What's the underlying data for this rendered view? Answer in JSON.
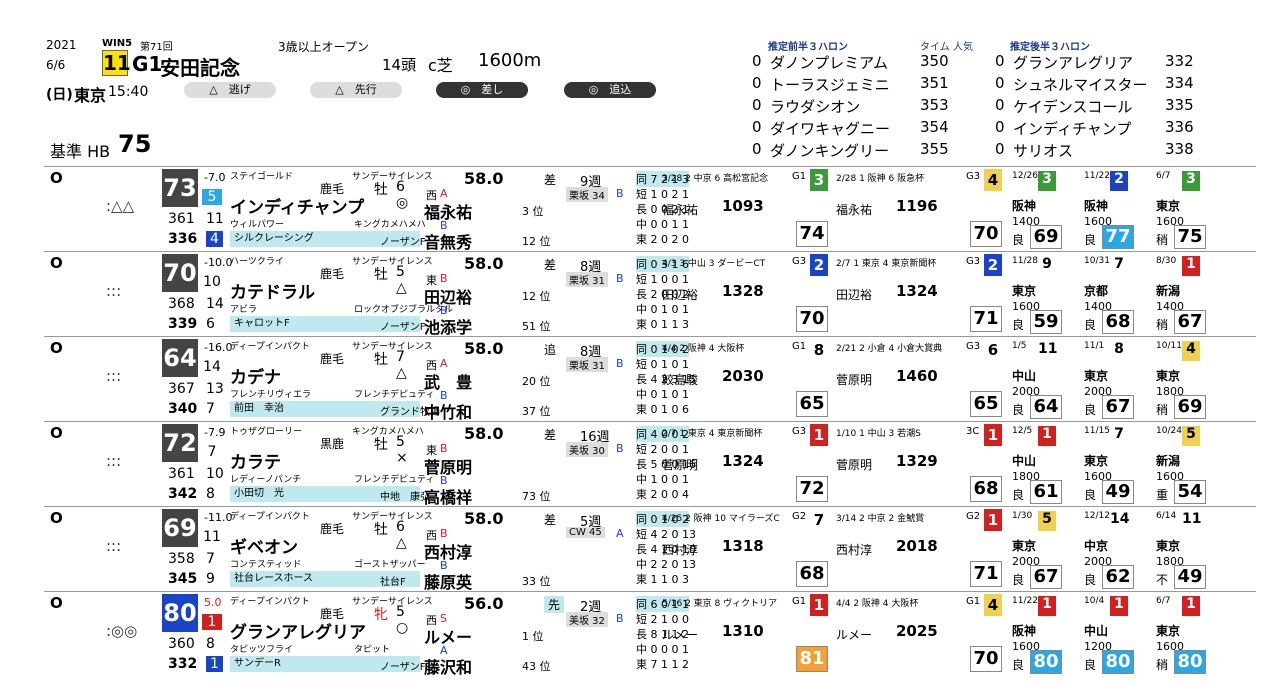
{
  "header": {
    "year": "2021",
    "date": "6/6",
    "win5": "WIN5",
    "kai": "第71回",
    "race_no": "11",
    "grade": "G1",
    "race_name": "安田記念",
    "condition": "3歳以上オープン",
    "runners": "14頭",
    "course": "c芝",
    "distance": "1600m",
    "day": "(日)",
    "place": "東京",
    "time": "15:40",
    "base_label": "基準 HB",
    "base_value": "75",
    "styles": [
      "△　逃げ",
      "△　先行",
      "◎　差し",
      "◎　追込"
    ]
  },
  "rank_heads": {
    "front": "推定前半３ハロン",
    "time_pop": "タイム 人気",
    "back": "推定後半３ハロン"
  },
  "front_rank": [
    {
      "mark": "0",
      "name": "ダノンプレミアム",
      "value": "350"
    },
    {
      "mark": "0",
      "name": "トーラスジェミニ",
      "value": "351"
    },
    {
      "mark": "0",
      "name": "ラウダシオン",
      "value": "353"
    },
    {
      "mark": "0",
      "name": "ダイワキャグニー",
      "value": "354"
    },
    {
      "mark": "0",
      "name": "ダノンキングリー",
      "value": "355"
    }
  ],
  "back_rank": [
    {
      "mark": "0",
      "name": "グランアレグリア",
      "value": "332"
    },
    {
      "mark": "0",
      "name": "シュネルマイスター",
      "value": "334"
    },
    {
      "mark": "0",
      "name": "ケイデンスコール",
      "value": "335"
    },
    {
      "mark": "0",
      "name": "インディチャンプ",
      "value": "336"
    },
    {
      "mark": "0",
      "name": "サリオス",
      "value": "338"
    }
  ],
  "horses": [
    {
      "mark": "O",
      "pred": ":△△",
      "score": "73",
      "d1": "-7.0",
      "wk": "5",
      "h1": "361",
      "h1n": "11",
      "h2": "336",
      "h2n": "4",
      "sire": "ステイゴールド",
      "bms": "サンデーサイレンス",
      "coat": "鹿毛",
      "sex": "牡",
      "age": "6",
      "name": "インディチャンプ",
      "fmark": "◎",
      "dam": "ウィルパワー",
      "damsire": "キングカメハメハ",
      "owner": "シルクレーシング",
      "farm": "ノーザンF",
      "weight": "58.0",
      "stable": "西",
      "stableRank": "A",
      "style": "差",
      "jockey": "福永祐",
      "jstat": "3 位",
      "trainer": "音無秀",
      "tstat": "12 位",
      "trainerRank": "B",
      "interval": "9週",
      "stat1": "栗坂 34",
      "r1": "B",
      "recs": [
        "同 7 2 1 3",
        "短 1 0 2 1",
        "長 0 0 2 1",
        "中 0 0 1 1",
        "東 2 0 2 0"
      ],
      "p1_head": "3/28 2 中京 6 高松宮記念",
      "p1_g": "G1",
      "p1_rank": "3",
      "p1_rc": "#3a9a3a",
      "p1_jockey": "福永祐",
      "p1_time": "1093",
      "p1_sc": "74",
      "p2_head": "2/28 1 阪神 6 阪急杯",
      "p2_g": "G3",
      "p2_rank": "4",
      "p2_rc": "#f0d050",
      "p2_jockey": "福永祐",
      "p2_time": "1196",
      "p2_sc": "70",
      "r3": [
        "12/26",
        "阪神",
        "1400",
        "良",
        "69",
        "3",
        "#3a9a3a"
      ],
      "r4": [
        "11/22",
        "阪神",
        "1600",
        "良",
        "77",
        "2",
        "#1a44c4"
      ],
      "r5": [
        "6/7",
        "東京",
        "1600",
        "稍",
        "75",
        "3",
        "#3a9a3a"
      ]
    },
    {
      "mark": "O",
      "pred": ":::",
      "score": "70",
      "d1": "-10.0",
      "wk": "10",
      "h1": "368",
      "h1n": "14",
      "h2": "339",
      "h2n": "6",
      "sire": "ハーツクライ",
      "bms": "サンデーサイレンス",
      "coat": "鹿毛",
      "sex": "牡",
      "age": "5",
      "name": "カテドラル",
      "fmark": "△",
      "dam": "アビラ",
      "damsire": "ロックオブジブラルタル",
      "owner": "キャロットF",
      "farm": "ノーザンF",
      "weight": "58.0",
      "stable": "東",
      "stableRank": "B",
      "style": "差",
      "jockey": "田辺裕",
      "jstat": "12 位",
      "trainer": "池添学",
      "tstat": "51 位",
      "trainerRank": "B",
      "interval": "8週",
      "stat1": "栗坂 31",
      "r1": "B",
      "recs": [
        "同 0 3 1 6",
        "短 1 0 0 1",
        "長 2 0 0 2",
        "中 0 1 0 1",
        "東 0 1 1 3"
      ],
      "p1_head": "4/3 3 中山 3 ダービーCT",
      "p1_g": "G3",
      "p1_rank": "2",
      "p1_rc": "#1a44c4",
      "p1_jockey": "田辺裕",
      "p1_time": "1328",
      "p1_sc": "70",
      "p2_head": "2/7 1 東京 4 東京新聞杯",
      "p2_g": "G3",
      "p2_rank": "2",
      "p2_rc": "#1a44c4",
      "p2_jockey": "田辺裕",
      "p2_time": "1324",
      "p2_sc": "71",
      "r3": [
        "11/28",
        "東京",
        "1600",
        "良",
        "59",
        "9",
        ""
      ],
      "r4": [
        "10/31",
        "京都",
        "1400",
        "良",
        "68",
        "7",
        ""
      ],
      "r5": [
        "8/30",
        "新潟",
        "1400",
        "稍",
        "67",
        "1",
        "#d02020"
      ]
    },
    {
      "mark": "O",
      "pred": ":::",
      "score": "64",
      "d1": "-16.0",
      "wk": "14",
      "h1": "367",
      "h1n": "13",
      "h2": "340",
      "h2n": "7",
      "sire": "ディープインパクト",
      "bms": "サンデーサイレンス",
      "coat": "鹿毛",
      "sex": "牡",
      "age": "7",
      "name": "カデナ",
      "fmark": "△",
      "dam": "フレンチリヴィエラ",
      "damsire": "フレンチデピュティ",
      "owner": "前田　幸治",
      "farm": "グランド牧場",
      "weight": "58.0",
      "stable": "西",
      "stableRank": "A",
      "style": "追",
      "jockey": "武　豊",
      "jstat": "20 位",
      "trainer": "中竹和",
      "tstat": "37 位",
      "trainerRank": "B",
      "interval": "8週",
      "stat1": "栗坂 31",
      "r1": "B",
      "recs": [
        "同 0 1 0 2",
        "短 0 1 0 1",
        "長 4 2 3 15",
        "中 0 1 0 1",
        "東 0 1 0 6"
      ],
      "p1_head": "4/4 2 阪神 4 大阪杯",
      "p1_g": "G1",
      "p1_rank": "8",
      "p1_rc": "",
      "p1_jockey": "鮫島駿",
      "p1_time": "2030",
      "p1_sc": "65",
      "p2_head": "2/21 2 小倉 4 小倉大賞典",
      "p2_g": "G3",
      "p2_rank": "6",
      "p2_rc": "",
      "p2_jockey": "菅原明",
      "p2_time": "1460",
      "p2_sc": "65",
      "r3": [
        "1/5",
        "中山",
        "2000",
        "良",
        "64",
        "11",
        ""
      ],
      "r4": [
        "11/1",
        "東京",
        "2000",
        "良",
        "67",
        "8",
        ""
      ],
      "r5": [
        "10/11",
        "東京",
        "1800",
        "稍",
        "69",
        "4",
        "#f0d050"
      ]
    },
    {
      "mark": "O",
      "pred": ":::",
      "score": "72",
      "d1": "-7.9",
      "wk": "7",
      "h1": "361",
      "h1n": "10",
      "h2": "342",
      "h2n": "8",
      "sire": "トゥザグローリー",
      "bms": "キングカメハメハ",
      "coat": "黒鹿",
      "sex": "牡",
      "age": "5",
      "name": "カラテ",
      "fmark": "×",
      "dam": "レディーノパンチ",
      "damsire": "フレンチデピュティ",
      "owner": "小田切　光",
      "farm": "中地　康弘",
      "weight": "58.0",
      "stable": "東",
      "stableRank": "B",
      "style": "差",
      "jockey": "菅原明",
      "jstat": "",
      "trainer": "高橋祥",
      "tstat": "73 位",
      "trainerRank": "B",
      "interval": "16週",
      "stat1": "美坂 30",
      "r1": "B",
      "recs": [
        "同 4 0 0 2",
        "短 2 0 0 1",
        "長 5 0 0 16",
        "中 1 0 0 1",
        "東 2 0 0 4"
      ],
      "p1_head": "2/7 1 東京 4 東京新聞杯",
      "p1_g": "G3",
      "p1_rank": "1",
      "p1_rc": "#d02020",
      "p1_jockey": "菅原明",
      "p1_time": "1324",
      "p1_sc": "72",
      "p2_head": "1/10 1 中山 3 若潮S",
      "p2_g": "3C",
      "p2_rank": "1",
      "p2_rc": "#d02020",
      "p2_jockey": "菅原明",
      "p2_time": "1329",
      "p2_sc": "68",
      "r3": [
        "12/5",
        "中山",
        "1800",
        "良",
        "61",
        "1",
        "#d02020"
      ],
      "r4": [
        "11/15",
        "東京",
        "1600",
        "良",
        "49",
        "7",
        ""
      ],
      "r5": [
        "10/24",
        "新潟",
        "1600",
        "重",
        "54",
        "5",
        "#f0d050"
      ]
    },
    {
      "mark": "O",
      "pred": ":::",
      "score": "69",
      "d1": "-11.0",
      "wk": "11",
      "h1": "358",
      "h1n": "7",
      "h2": "345",
      "h2n": "9",
      "sire": "ディープインパクト",
      "bms": "サンデーサイレンス",
      "coat": "鹿毛",
      "sex": "牡",
      "age": "6",
      "name": "ギベオン",
      "fmark": "△",
      "dam": "コンテスティッド",
      "damsire": "ゴーストザッパー",
      "owner": "社台レースホース",
      "farm": "社台F",
      "weight": "58.0",
      "stable": "西",
      "stableRank": "B",
      "style": "差",
      "jockey": "西村淳",
      "jstat": "",
      "trainer": "藤原英",
      "tstat": "33 位",
      "trainerRank": "B",
      "interval": "5週",
      "stat1": "CW 45",
      "r1": "A",
      "recs": [
        "同 0 1 0 2",
        "短 4 2 0 13",
        "長 4 1 0 10",
        "中 2 2 0 13",
        "東 1 1 0 3"
      ],
      "p1_head": "4/25 2 阪神 10 マイラーズC",
      "p1_g": "G2",
      "p1_rank": "7",
      "p1_rc": "",
      "p1_jockey": "西村淳",
      "p1_time": "1318",
      "p1_sc": "68",
      "p2_head": "3/14 2 中京 2 金鯱賞",
      "p2_g": "G2",
      "p2_rank": "1",
      "p2_rc": "#d02020",
      "p2_jockey": "西村淳",
      "p2_time": "2018",
      "p2_sc": "71",
      "r3": [
        "1/30",
        "東京",
        "2000",
        "良",
        "67",
        "5",
        "#f0d050"
      ],
      "r4": [
        "12/12",
        "中京",
        "2000",
        "良",
        "62",
        "14",
        ""
      ],
      "r5": [
        "6/14",
        "東京",
        "1800",
        "不",
        "49",
        "11",
        ""
      ]
    },
    {
      "mark": "O",
      "pred": ":◎◎",
      "score": "80",
      "d1": "5.0",
      "wk": "1",
      "h1": "360",
      "h1n": "8",
      "h2": "332",
      "h2n": "1",
      "sire": "ディープインパクト",
      "bms": "サンデーサイレンス",
      "coat": "鹿毛",
      "sex": "牝",
      "age": "5",
      "name": "グランアレグリア",
      "fmark": "○",
      "dam": "タピッツフライ",
      "damsire": "タピット",
      "owner": "サンデーR",
      "farm": "ノーザンF",
      "weight": "56.0",
      "stable": "西",
      "stableRank": "S",
      "style": "先",
      "jockey": "ルメー",
      "jstat": "1 位",
      "trainer": "藤沢和",
      "tstat": "43 位",
      "trainerRank": "A",
      "interval": "2週",
      "stat1": "美坂 32",
      "r1": "B",
      "recs": [
        "同 6 0 1 1",
        "短 2 1 0 0",
        "長 8 1 1 2",
        "中 0 0 0 1",
        "東 7 1 1 2"
      ],
      "p1_head": "5/16 2 東京 8 ヴィクトリア",
      "p1_g": "G1",
      "p1_rank": "1",
      "p1_rc": "#d02020",
      "p1_jockey": "ルメー",
      "p1_time": "1310",
      "p1_sc": "81",
      "p2_head": "4/4 2 阪神 4 大阪杯",
      "p2_g": "G1",
      "p2_rank": "4",
      "p2_rc": "#f0d050",
      "p2_jockey": "ルメー",
      "p2_time": "2025",
      "p2_sc": "70",
      "r3": [
        "11/22",
        "阪神",
        "1600",
        "良",
        "80",
        "1",
        "#d02020"
      ],
      "r4": [
        "10/4",
        "中山",
        "1200",
        "良",
        "80",
        "1",
        "#d02020"
      ],
      "r5": [
        "6/7",
        "東京",
        "1600",
        "稍",
        "80",
        "1",
        "#d02020"
      ]
    }
  ]
}
